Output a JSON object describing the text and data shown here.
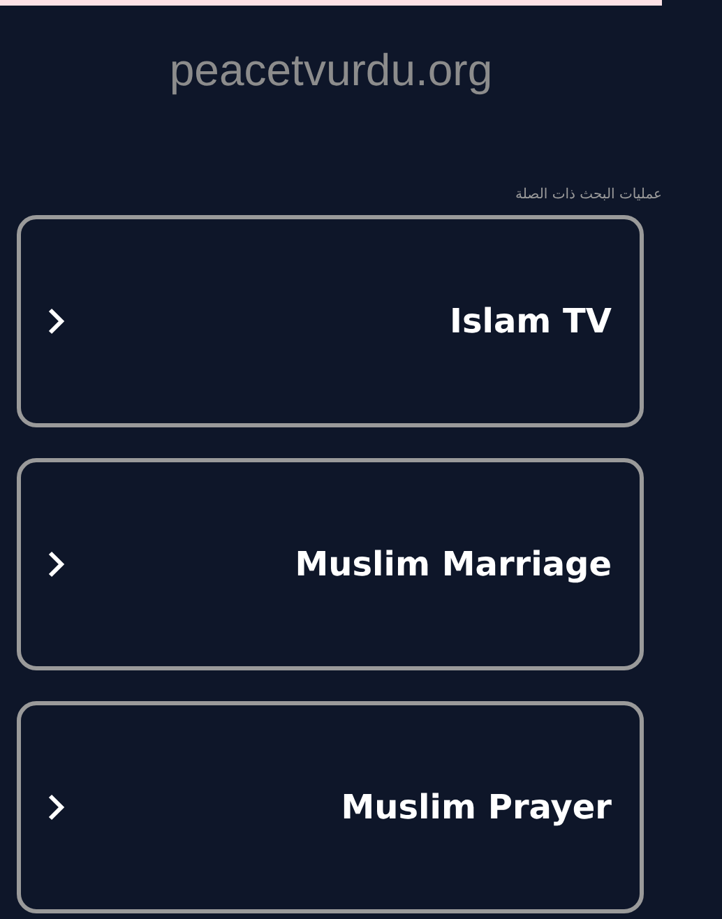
{
  "site_title": "peacetvurdu.org",
  "related_label": "عمليات البحث ذات الصلة",
  "links": [
    {
      "label": "Islam TV"
    },
    {
      "label": "Muslim Marriage"
    },
    {
      "label": "Muslim Prayer"
    }
  ]
}
